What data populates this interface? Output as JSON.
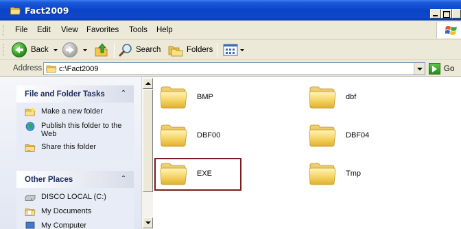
{
  "window": {
    "title": "Fact2009"
  },
  "menu": [
    "File",
    "Edit",
    "View",
    "Favorites",
    "Tools",
    "Help"
  ],
  "toolbar": {
    "back": "Back",
    "search": "Search",
    "folders": "Folders"
  },
  "address": {
    "label": "Address",
    "value": "c:\\Fact2009",
    "go": "Go"
  },
  "tasks_panel": {
    "title": "File and Folder Tasks",
    "items": [
      "Make a new folder",
      "Publish this folder to the Web",
      "Share this folder"
    ]
  },
  "places_panel": {
    "title": "Other Places",
    "items": [
      "DISCO LOCAL (C:)",
      "My Documents",
      "My Computer"
    ]
  },
  "folders": [
    "BMP",
    "dbf",
    "DBF00",
    "DBF04",
    "EXE",
    "Tmp"
  ],
  "selected_folder": "EXE"
}
